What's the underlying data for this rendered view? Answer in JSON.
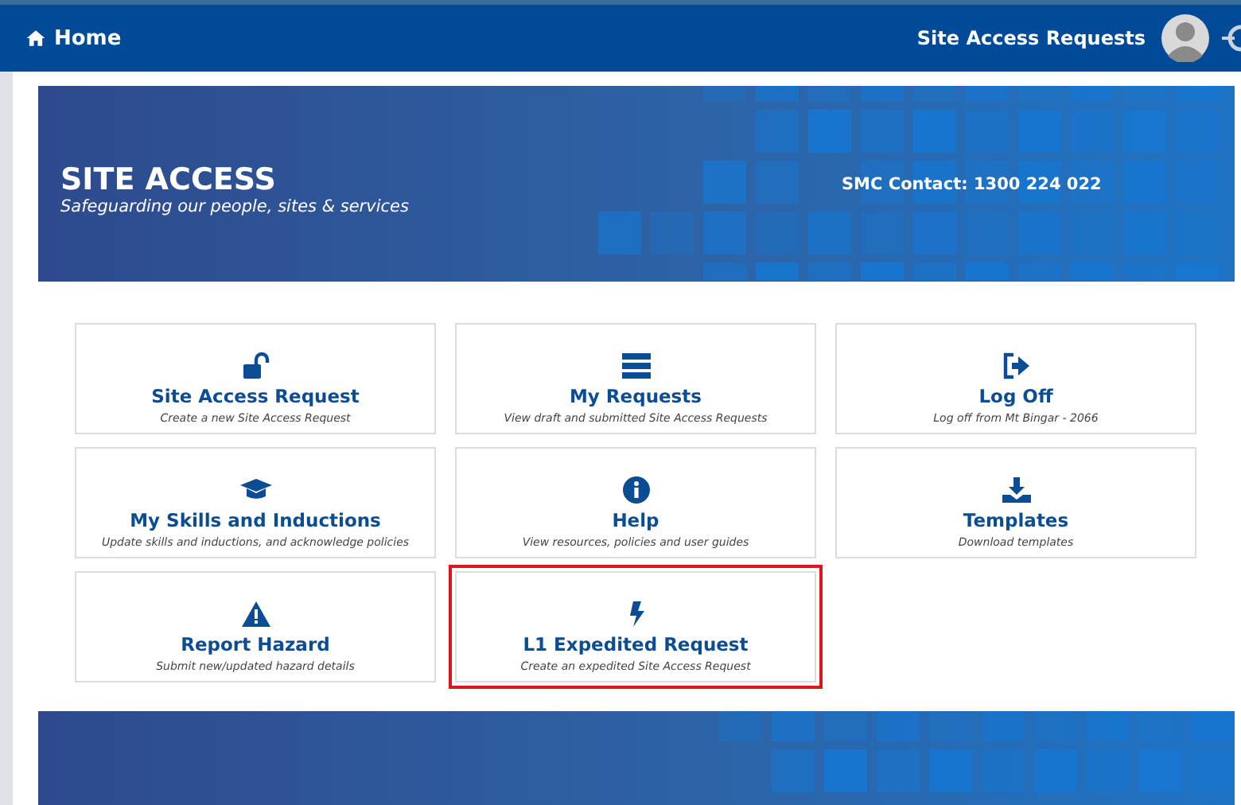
{
  "navbar": {
    "home_label": "Home",
    "app_title": "Site Access Requests"
  },
  "banner": {
    "title": "SITE ACCESS",
    "tagline": "Safeguarding our people, sites & services",
    "contact": "SMC Contact: 1300 224 022"
  },
  "tiles": [
    {
      "title": "Site Access Request",
      "subtitle": "Create a new Site Access Request",
      "highlighted": false
    },
    {
      "title": "My Requests",
      "subtitle": "View draft and submitted Site Access Requests",
      "highlighted": false
    },
    {
      "title": "Log Off",
      "subtitle": "Log off from Mt Bingar - 2066",
      "highlighted": false
    },
    {
      "title": "My Skills and Inductions",
      "subtitle": "Update skills and inductions, and acknowledge policies",
      "highlighted": false
    },
    {
      "title": "Help",
      "subtitle": "View resources, policies and user guides",
      "highlighted": false
    },
    {
      "title": "Templates",
      "subtitle": "Download templates",
      "highlighted": false
    },
    {
      "title": "Report Hazard",
      "subtitle": "Submit new/updated hazard details",
      "highlighted": false
    },
    {
      "title": "L1 Expedited Request",
      "subtitle": "Create an expedited Site Access Request",
      "highlighted": true
    }
  ]
}
